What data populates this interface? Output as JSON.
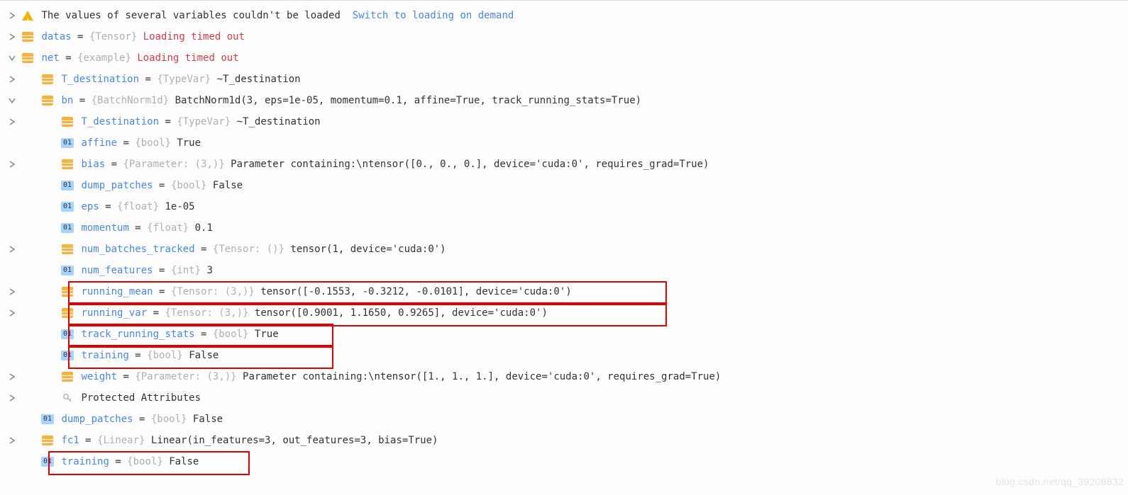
{
  "header": {
    "message": "The values of several variables couldn't be loaded",
    "link": "Switch to loading on demand"
  },
  "gap": " ",
  "eq": " = ",
  "prim_label": "01",
  "rows": [
    {
      "k": "warning",
      "indent": 0,
      "chev": ">"
    },
    {
      "k": "obj",
      "indent": 0,
      "chev": ">",
      "name": "datas",
      "type": "{Tensor}",
      "value": "Loading timed out",
      "err": true
    },
    {
      "k": "obj",
      "indent": 0,
      "chev": "v",
      "name": "net",
      "type": "{example}",
      "value": "Loading timed out",
      "err": true
    },
    {
      "k": "obj",
      "indent": 1,
      "chev": ">",
      "name": "T_destination",
      "type": "{TypeVar}",
      "value": "~T_destination"
    },
    {
      "k": "obj",
      "indent": 1,
      "chev": "v",
      "name": "bn",
      "type": "{BatchNorm1d}",
      "value": "BatchNorm1d(3, eps=1e-05, momentum=0.1, affine=True, track_running_stats=True)"
    },
    {
      "k": "obj",
      "indent": 2,
      "chev": ">",
      "name": "T_destination",
      "type": "{TypeVar}",
      "value": "~T_destination"
    },
    {
      "k": "prim",
      "indent": 2,
      "name": "affine",
      "type": "{bool}",
      "value": "True"
    },
    {
      "k": "obj",
      "indent": 2,
      "chev": ">",
      "name": "bias",
      "type": "{Parameter: (3,)}",
      "value": "Parameter containing:\\ntensor([0., 0., 0.], device='cuda:0', requires_grad=True)"
    },
    {
      "k": "prim",
      "indent": 2,
      "name": "dump_patches",
      "type": "{bool}",
      "value": "False"
    },
    {
      "k": "prim",
      "indent": 2,
      "name": "eps",
      "type": "{float}",
      "value": "1e-05"
    },
    {
      "k": "prim",
      "indent": 2,
      "name": "momentum",
      "type": "{float}",
      "value": "0.1"
    },
    {
      "k": "obj",
      "indent": 2,
      "chev": ">",
      "name": "num_batches_tracked",
      "type": "{Tensor: ()}",
      "value": "tensor(1, device='cuda:0')"
    },
    {
      "k": "prim",
      "indent": 2,
      "name": "num_features",
      "type": "{int}",
      "value": "3"
    },
    {
      "k": "obj",
      "indent": 2,
      "chev": ">",
      "name": "running_mean",
      "type": "{Tensor: (3,)}",
      "value": "tensor([-0.1553, -0.3212, -0.0101], device='cuda:0')",
      "hl": true,
      "hlw": 840
    },
    {
      "k": "obj",
      "indent": 2,
      "chev": ">",
      "name": "running_var",
      "type": "{Tensor: (3,)}",
      "value": "tensor([0.9001, 1.1650, 0.9265], device='cuda:0')",
      "hl": true,
      "hlw": 840
    },
    {
      "k": "prim",
      "indent": 2,
      "name": "track_running_stats",
      "type": "{bool}",
      "value": "True",
      "hl": true,
      "hlw": 370
    },
    {
      "k": "prim",
      "indent": 2,
      "name": "training",
      "type": "{bool}",
      "value": "False",
      "hl": true,
      "hlw": 370
    },
    {
      "k": "obj",
      "indent": 2,
      "chev": ">",
      "name": "weight",
      "type": "{Parameter: (3,)}",
      "value": "Parameter containing:\\ntensor([1., 1., 1.], device='cuda:0', requires_grad=True)"
    },
    {
      "k": "key",
      "indent": 2,
      "chev": ">",
      "label": "Protected Attributes"
    },
    {
      "k": "prim",
      "indent": 1,
      "name": "dump_patches",
      "type": "{bool}",
      "value": "False"
    },
    {
      "k": "obj",
      "indent": 1,
      "chev": ">",
      "name": "fc1",
      "type": "{Linear}",
      "value": "Linear(in_features=3, out_features=3, bias=True)"
    },
    {
      "k": "prim",
      "indent": 1,
      "name": "training",
      "type": "{bool}",
      "value": "False",
      "hl": true,
      "hlw": 280
    }
  ],
  "watermark": "blog.csdn.net/qq_39208832"
}
